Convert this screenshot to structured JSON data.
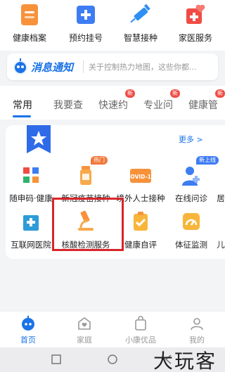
{
  "top_services": [
    {
      "label": "健康档案",
      "icon": "health-record-icon",
      "color": "#f7923b"
    },
    {
      "label": "预约挂号",
      "icon": "appointment-icon",
      "color": "#3d7cf2"
    },
    {
      "label": "智慧接种",
      "icon": "vaccine-syringe-icon",
      "color": "#2f8ff2"
    },
    {
      "label": "家医服务",
      "icon": "family-doctor-icon",
      "color": "#f04c45"
    }
  ],
  "notice": {
    "brand": "消息通知",
    "message": "关于控制热力地图，这些你都..."
  },
  "tabs": [
    {
      "label": "常用",
      "badge": "",
      "active": true
    },
    {
      "label": "我要查",
      "badge": ""
    },
    {
      "label": "快速约",
      "badge": "新"
    },
    {
      "label": "专业问",
      "badge": "新"
    },
    {
      "label": "健康管",
      "badge": "新"
    }
  ],
  "card": {
    "more_label": "更多 >",
    "row1": [
      {
        "label": "随申码·健康",
        "icon": "qr-code-icon",
        "tag": ""
      },
      {
        "label": "新冠疫苗接种",
        "icon": "vaccine-bottle-icon",
        "tag": "热门",
        "tag_color": "#f0783a"
      },
      {
        "label": "境外人士接种",
        "icon": "covid19-icon",
        "tag": ""
      },
      {
        "label": "在线问诊",
        "icon": "doctor-icon",
        "tag": "新上线",
        "tag_color": "#3d7cf2"
      },
      {
        "label": "居",
        "icon": "partial-icon",
        "tag": ""
      }
    ],
    "row2": [
      {
        "label": "互联网医院",
        "icon": "hospital-icon",
        "tag": ""
      },
      {
        "label": "核酸检测服务",
        "icon": "microscope-icon",
        "tag": ""
      },
      {
        "label": "健康自评",
        "icon": "self-assess-icon",
        "tag": ""
      },
      {
        "label": "体征监测",
        "icon": "gauge-icon",
        "tag": ""
      },
      {
        "label": "儿",
        "icon": "partial-icon",
        "tag": ""
      }
    ]
  },
  "bottom_nav": [
    {
      "label": "首页",
      "icon": "home-robot-icon",
      "active": true
    },
    {
      "label": "家庭",
      "icon": "family-heart-icon"
    },
    {
      "label": "小康优品",
      "icon": "shopping-bag-icon"
    },
    {
      "label": "我的",
      "icon": "profile-icon"
    }
  ],
  "watermark": "大玩客"
}
